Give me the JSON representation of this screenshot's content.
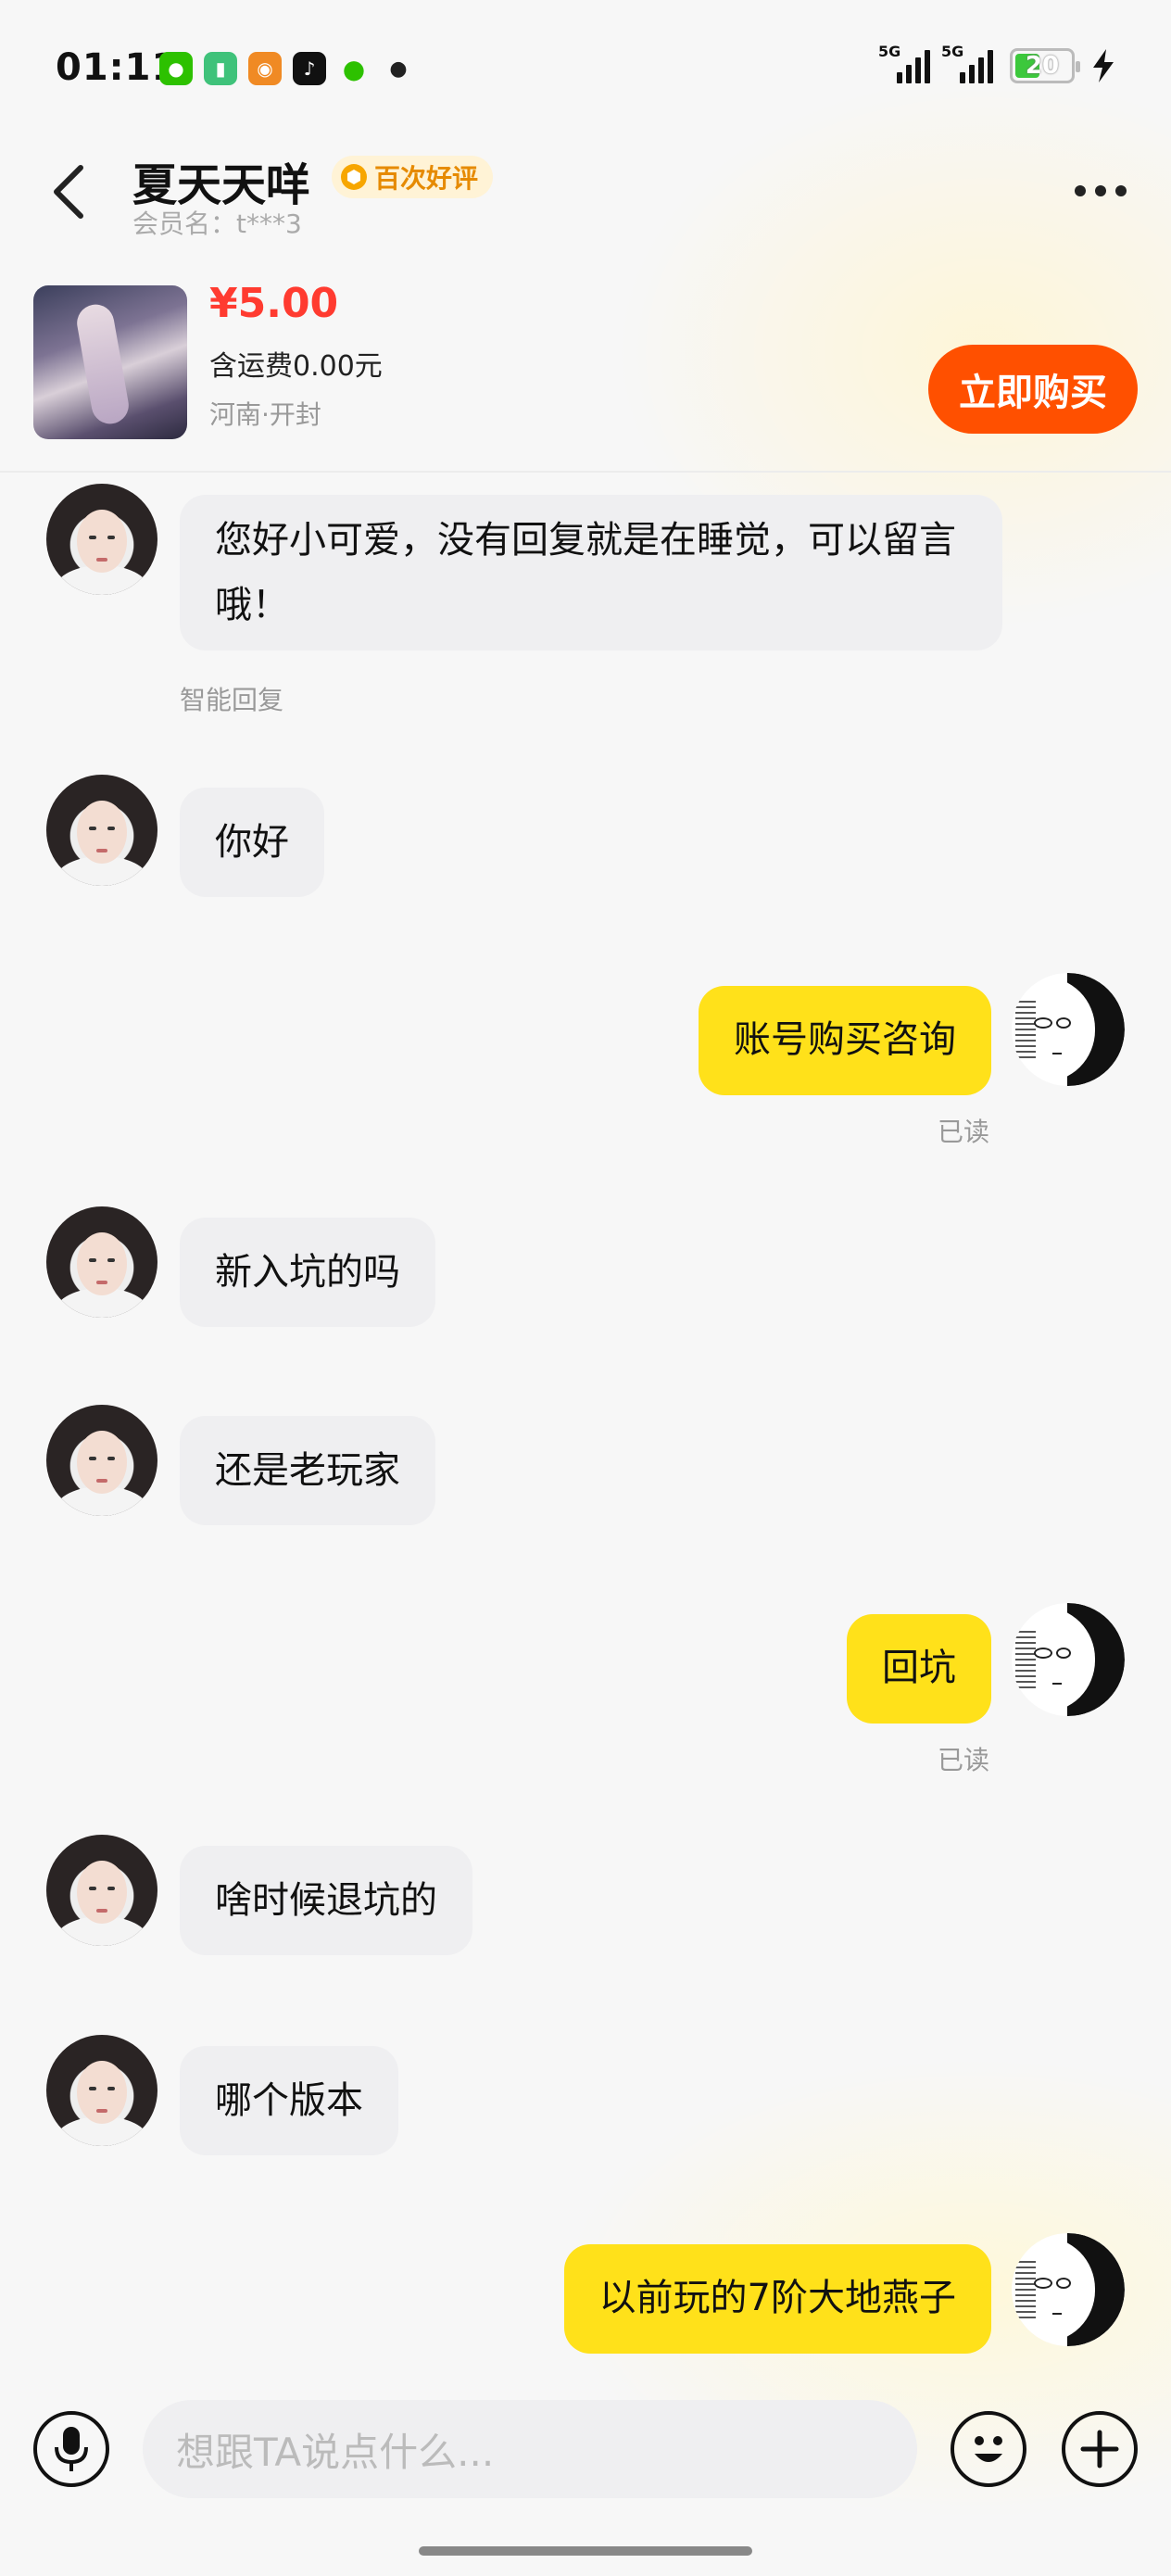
{
  "status_bar": {
    "time": "01:11",
    "network_1": "5G",
    "network_2": "5G",
    "battery": "20"
  },
  "header": {
    "title": "夏天天咩",
    "badge": "百次好评",
    "member": "会员名：t***3"
  },
  "product": {
    "price": "¥5.00",
    "shipping": "含运费0.00元",
    "location": "河南·开封",
    "buy_label": "立即购买"
  },
  "messages": [
    {
      "side": "left",
      "text": "您好小可爱，没有回复就是在睡觉，可以留言哦！",
      "meta": "智能回复"
    },
    {
      "side": "left",
      "text": "你好"
    },
    {
      "side": "right",
      "text": "账号购买咨询",
      "meta": "已读"
    },
    {
      "side": "left",
      "text": "新入坑的吗"
    },
    {
      "side": "left",
      "text": "还是老玩家"
    },
    {
      "side": "right",
      "text": "回坑",
      "meta": "已读"
    },
    {
      "side": "left",
      "text": "啥时候退坑的"
    },
    {
      "side": "left",
      "text": "哪个版本"
    },
    {
      "side": "right",
      "text": "以前玩的7阶大地燕子"
    }
  ],
  "input": {
    "placeholder": "想跟TA说点什么..."
  },
  "colors": {
    "accent": "#ff5000",
    "price": "#ff3b30",
    "my_bubble": "#ffe11a",
    "their_bubble": "#efeff1"
  }
}
